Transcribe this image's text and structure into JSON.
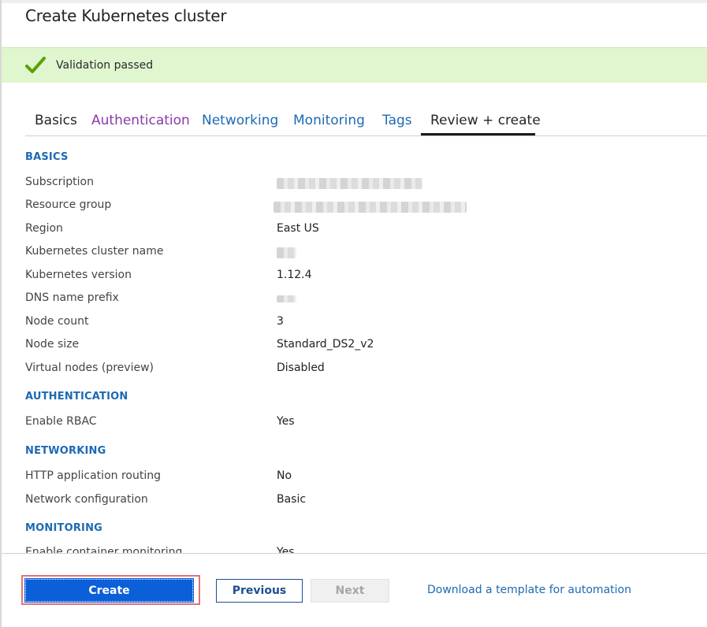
{
  "page": {
    "title": "Create Kubernetes cluster"
  },
  "validation": {
    "message": "Validation passed",
    "color": "#dff6cf",
    "icon": "checkmark-icon"
  },
  "tabs": [
    {
      "label": "Basics"
    },
    {
      "label": "Authentication"
    },
    {
      "label": "Networking"
    },
    {
      "label": "Monitoring"
    },
    {
      "label": "Tags"
    },
    {
      "label": "Review + create",
      "active": true
    }
  ],
  "sections": {
    "basics": {
      "heading": "BASICS",
      "rows": [
        {
          "label": "Subscription",
          "value": ""
        },
        {
          "label": "Resource group",
          "value": ""
        },
        {
          "label": "Region",
          "value": "East US"
        },
        {
          "label": "Kubernetes cluster name",
          "value": ""
        },
        {
          "label": "Kubernetes version",
          "value": "1.12.4"
        },
        {
          "label": "DNS name prefix",
          "value": ""
        },
        {
          "label": "Node count",
          "value": "3"
        },
        {
          "label": "Node size",
          "value": "Standard_DS2_v2"
        },
        {
          "label": "Virtual nodes (preview)",
          "value": "Disabled"
        }
      ]
    },
    "authentication": {
      "heading": "AUTHENTICATION",
      "rows": [
        {
          "label": "Enable RBAC",
          "value": "Yes"
        }
      ]
    },
    "networking": {
      "heading": "NETWORKING",
      "rows": [
        {
          "label": "HTTP application routing",
          "value": "No"
        },
        {
          "label": "Network configuration",
          "value": "Basic"
        }
      ]
    },
    "monitoring": {
      "heading": "MONITORING",
      "rows": [
        {
          "label": "Enable container monitoring",
          "value": "Yes"
        }
      ]
    }
  },
  "footer": {
    "create_label": "Create",
    "previous_label": "Previous",
    "next_label": "Next",
    "download_label": "Download a template for automation"
  },
  "colors": {
    "accent": "#0b5fd8",
    "link": "#1d6ab3",
    "visited_link": "#8a3aa8",
    "highlight_border": "#e0737a"
  }
}
